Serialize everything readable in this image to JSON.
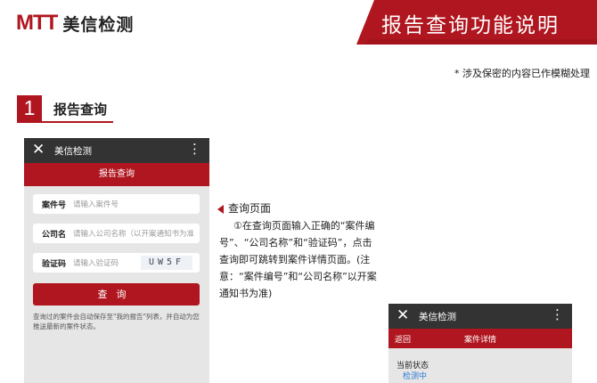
{
  "brand": {
    "logo_mark": "MTT",
    "name": "美信检测",
    "accent": "#b0161f"
  },
  "header_title": "报告查询功能说明",
  "note": "* 涉及保密的内容已作模糊处理",
  "section": {
    "number": "1",
    "title": "报告查询"
  },
  "phone1": {
    "app_title": "美信检测",
    "close_icon": "close-icon",
    "more_icon": "more-vertical-icon",
    "bar_title": "报告查询",
    "fields": [
      {
        "label": "案件号",
        "placeholder": "请输入案件号"
      },
      {
        "label": "公司名",
        "placeholder": "请输入公司名称（以开案通知书为准）"
      },
      {
        "label": "验证码",
        "placeholder": "请输入验证码",
        "captcha": "UW5F"
      }
    ],
    "query_button": "查询",
    "tip": "查询过的案件会自动保存至\"我的报告\"列表，并自动为您推送最新的案件状态。"
  },
  "description": {
    "title": "查询页面",
    "body": "①在查询页面输入正确的“案件编号”、“公司名称”和“验证码”，点击查询即可跳转到案件详情页面。(注意：“案件编号”和“公司名称”以开案通知书为准)"
  },
  "phone2": {
    "app_title": "美信检测",
    "back": "返回",
    "bar_title": "案件详情",
    "status_label": "当前状态",
    "status_value": "检测中"
  }
}
